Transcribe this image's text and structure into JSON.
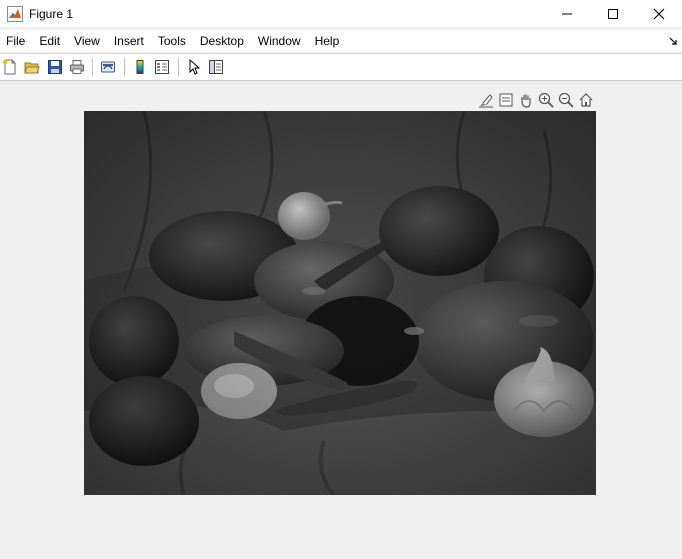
{
  "window": {
    "title": "Figure 1",
    "controls": [
      "minimize-icon",
      "maximize-icon",
      "close-icon"
    ]
  },
  "menu": {
    "items": [
      "File",
      "Edit",
      "View",
      "Insert",
      "Tools",
      "Desktop",
      "Window",
      "Help"
    ]
  },
  "toolbar": {
    "buttons": [
      "new-figure-icon",
      "open-file-icon",
      "save-icon",
      "print-icon",
      "link-plot-icon",
      "insert-colorbar-icon",
      "insert-legend-icon",
      "edit-plot-icon",
      "property-inspector-icon"
    ]
  },
  "axes_toolbar": {
    "buttons": [
      "brush-icon",
      "data-tips-icon",
      "pan-icon",
      "zoom-in-icon",
      "zoom-out-icon",
      "restore-view-icon"
    ]
  },
  "image": {
    "description_name": "peppers-grayscale-image",
    "colormap": "gray"
  },
  "colors": {
    "window_bg": "#f0f0f0",
    "titlebar_bg": "#ffffff",
    "accent": "#e05a1a"
  }
}
